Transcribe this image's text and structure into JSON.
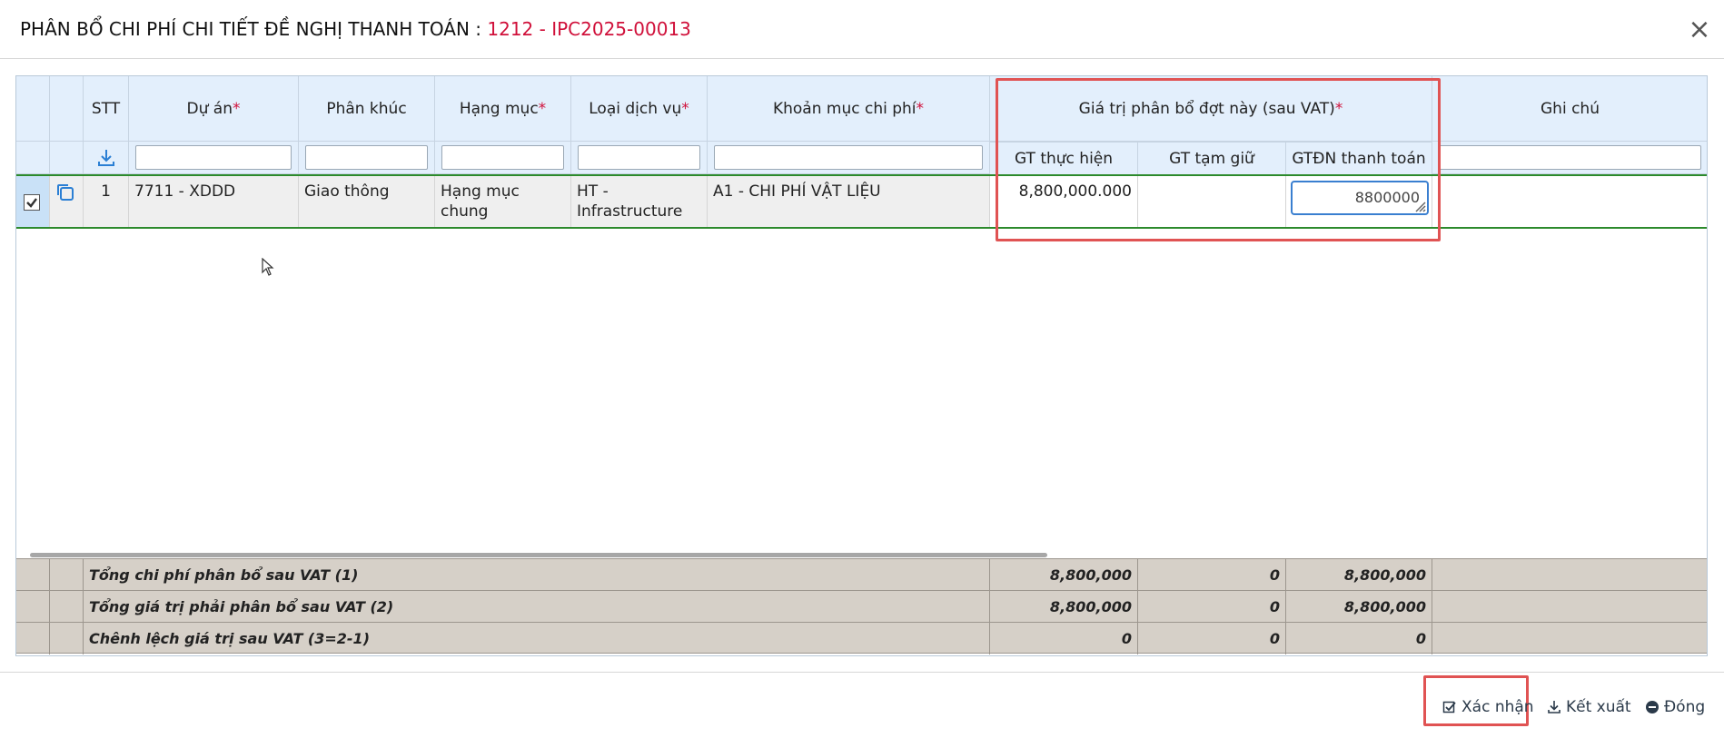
{
  "dialog": {
    "title_prefix": "PHÂN BỔ CHI PHÍ CHI TIẾT ĐỀ NGHỊ THANH TOÁN : ",
    "title_code": "1212 - IPC2025-00013",
    "close_symbol": "×"
  },
  "grid": {
    "headers": {
      "stt": "STT",
      "du_an": "Dự án",
      "phan_khuc": "Phân khúc",
      "hang_muc": "Hạng mục",
      "loai_dich_vu": "Loại dịch vụ",
      "khoan_muc": "Khoản mục chi phí",
      "gia_tri_group": "Giá trị phân bổ đợt này (sau VAT)",
      "gt_thuc_hien": "GT thực hiện",
      "gt_tam_giu": "GT tạm giữ",
      "gtdn_thanh_toan": "GTĐN thanh toán",
      "ghi_chu": "Ghi chú",
      "required_mark": "*"
    },
    "rows": [
      {
        "stt": "1",
        "du_an": "7711 - XDDD",
        "phan_khuc": "Giao thông",
        "hang_muc": "Hạng mục chung",
        "loai_dich_vu_line1": "HT -",
        "loai_dich_vu_line2": "Infrastructure",
        "khoan_muc": "A1 - CHI PHÍ VẬT LIỆU",
        "gt_thuc_hien": "8,800,000.000",
        "gt_tam_giu": "",
        "gtdn_thanh_toan_input": "8800000",
        "ghi_chu": ""
      }
    ],
    "summary": [
      {
        "label": "Tổng chi phí phân bổ sau VAT (1)",
        "gt_thuc_hien": "8,800,000",
        "gt_tam_giu": "0",
        "gtdn": "8,800,000"
      },
      {
        "label": "Tổng giá trị phải phân bổ sau VAT (2)",
        "gt_thuc_hien": "8,800,000",
        "gt_tam_giu": "0",
        "gtdn": "8,800,000"
      },
      {
        "label": "Chênh lệch giá trị sau VAT (3=2-1)",
        "gt_thuc_hien": "0",
        "gt_tam_giu": "0",
        "gtdn": "0"
      }
    ]
  },
  "footer": {
    "confirm": "Xác nhận",
    "export": "Kết xuất",
    "close": "Đóng"
  },
  "icons": {
    "download": "download-icon",
    "copy": "copy-icon",
    "check": "check-icon"
  },
  "colors": {
    "accent_red": "#d0103a",
    "header_bg": "#e3effc",
    "highlight": "#e05353",
    "row_border": "#2c8a2c",
    "summary_bg": "#d6d0c8"
  }
}
